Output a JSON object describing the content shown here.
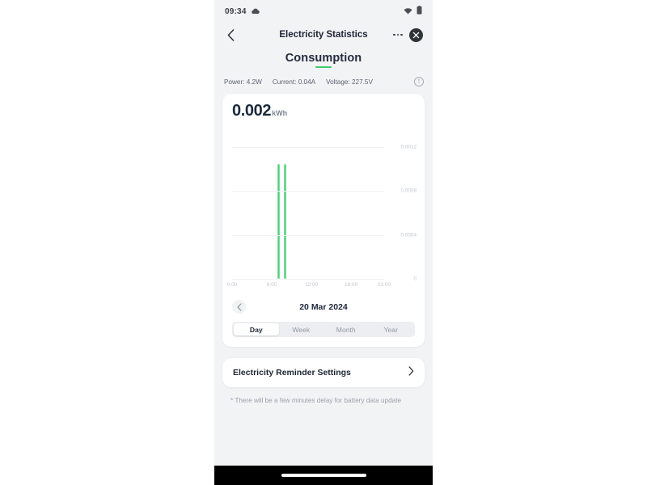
{
  "status_bar": {
    "time": "09:34",
    "weather_icon": "cloud-icon",
    "wifi_icon": "wifi-icon",
    "battery_icon": "battery-icon"
  },
  "header": {
    "back_icon": "chevron-left-icon",
    "title": "Electricity Statistics",
    "menu_icon": "more-options-icon",
    "close_icon": "close-circle-icon"
  },
  "section": {
    "title": "Consumption",
    "accent_color": "#41cb6a"
  },
  "stats": [
    {
      "label": "Power: 4.2W"
    },
    {
      "label": "Current: 0.04A"
    },
    {
      "label": "Voltage: 227.5V"
    }
  ],
  "info_icon_glyph": "!",
  "summary": {
    "value": "0.002",
    "unit": "kWh"
  },
  "date_nav": {
    "prev_icon": "chevron-left-icon",
    "date": "20 Mar 2024"
  },
  "range_tabs": [
    {
      "label": "Day",
      "active": true
    },
    {
      "label": "Week",
      "active": false
    },
    {
      "label": "Month",
      "active": false
    },
    {
      "label": "Year",
      "active": false
    }
  ],
  "reminder": {
    "label": "Electricity Reminder Settings",
    "chevron_icon": "chevron-right-icon"
  },
  "footnote": "* There will be a few minutes delay for battery data update",
  "chart_data": {
    "type": "bar",
    "title": "Consumption",
    "xlabel": "",
    "ylabel": "kWh",
    "unit": "kWh",
    "total": 0.002,
    "x_tick_labels": [
      "0:00",
      "6:00",
      "12:00",
      "18:00",
      "23:00"
    ],
    "x_tick_hours": [
      0,
      6,
      12,
      18,
      23
    ],
    "x_range_hours": [
      0,
      23
    ],
    "y_tick_labels": [
      "0.0012",
      "0.0008",
      "0.0004",
      "0"
    ],
    "y_tick_values": [
      0.0012,
      0.0008,
      0.0004,
      0
    ],
    "ylim": [
      0,
      0.0014
    ],
    "grid": true,
    "legend": "none",
    "bar_color": "#4ed07a",
    "categories": [
      "7:00",
      "8:00"
    ],
    "values": [
      0.00105,
      0.00105
    ]
  }
}
